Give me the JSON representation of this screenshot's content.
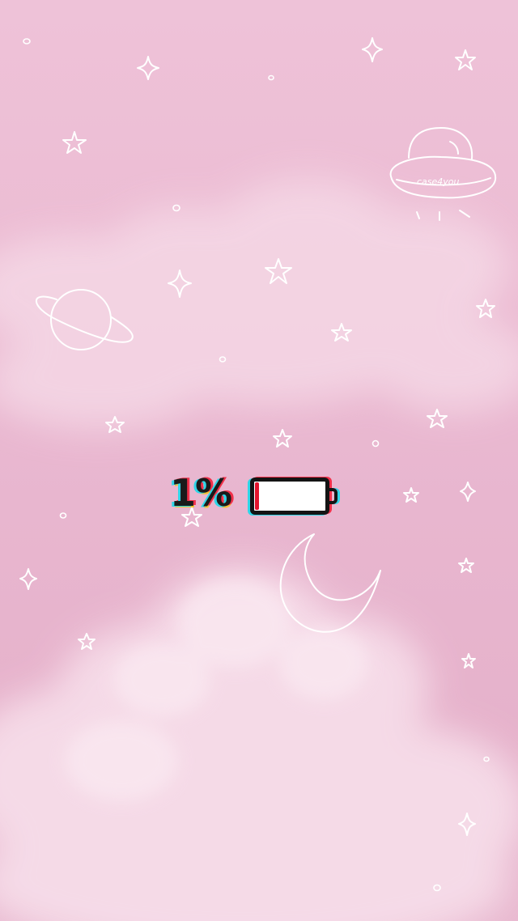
{
  "wallpaper": {
    "background_top": "#eec2d8",
    "background_bottom": "#e8b8cf",
    "cloud_color": "#f7dfeb",
    "doodle_color": "#ffffff",
    "doodles": [
      "ufo-icon",
      "planet-icon",
      "crescent-moon-icon",
      "sparkle-star-icon",
      "five-point-star-icon",
      "dot-circle-icon"
    ],
    "ufo_caption": "case4you"
  },
  "battery": {
    "percent_text": "1%",
    "level": 0.06,
    "fill_color": "#e2142c",
    "glitch_colors": [
      "#2fd6e8",
      "#f0304a",
      "#f2c230"
    ]
  }
}
